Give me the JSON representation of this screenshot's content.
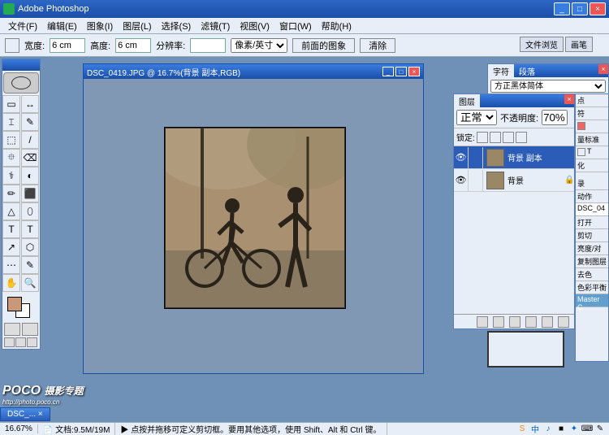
{
  "app": {
    "title": "Adobe Photoshop"
  },
  "menu": [
    "文件(F)",
    "编辑(E)",
    "图象(I)",
    "图层(L)",
    "选择(S)",
    "滤镜(T)",
    "视图(V)",
    "窗口(W)",
    "帮助(H)"
  ],
  "options": {
    "width_label": "宽度:",
    "width_value": "6 cm",
    "height_label": "高度:",
    "height_value": "6 cm",
    "res_label": "分辨率:",
    "unit": "像素/英寸",
    "front_btn": "前面的图象",
    "clear_btn": "清除"
  },
  "right_tabs": [
    "文件浏览",
    "画笔"
  ],
  "doc": {
    "title": "DSC_0419.JPG @ 16.7%(背景 副本,RGB)"
  },
  "char_panel": {
    "tabs": [
      "字符",
      "段落"
    ],
    "font": "方正黑体简体"
  },
  "layer_panel": {
    "tab": "图层",
    "blend": "正常",
    "opacity_label": "不透明度:",
    "opacity": "70%",
    "lock_label": "锁定:",
    "layers": [
      {
        "name": "背景 副本",
        "selected": true,
        "locked": false
      },
      {
        "name": "背景",
        "selected": false,
        "locked": true
      }
    ]
  },
  "right_strip": {
    "top": [
      "点",
      "符"
    ],
    "swatch_icons": [
      "",
      "量标准"
    ],
    "row2": [
      "T",
      "",
      ""
    ],
    "row3": "化",
    "hist_tabs": [
      "录",
      "动作"
    ],
    "hist_title": "DSC_04",
    "hist_items": [
      "打开",
      "剪切",
      "亮度/对",
      "复制图层",
      "去色",
      "色彩平衡",
      "Master C"
    ]
  },
  "watermark": {
    "brand": "POCO",
    "sub": "摄影专题",
    "url": "http://photo.poco.cn"
  },
  "taskbar": {
    "doc": "DSC_... ×"
  },
  "status": {
    "zoom": "16.67%",
    "info": "文档:9.5M/19M",
    "hint": "点按并拖移可定义剪切框。要用其他选项，使用 Shift、Alt 和 Ctrl 键。"
  },
  "tools": [
    "▭",
    "↔",
    "⌶",
    "✎",
    "⬚",
    "/",
    "⯐",
    "⌫",
    "⚕",
    "◐",
    "✏",
    "⬛",
    "△",
    "⬯",
    "T",
    "↗",
    "⬡",
    "✋",
    "🔍",
    "⋯"
  ]
}
